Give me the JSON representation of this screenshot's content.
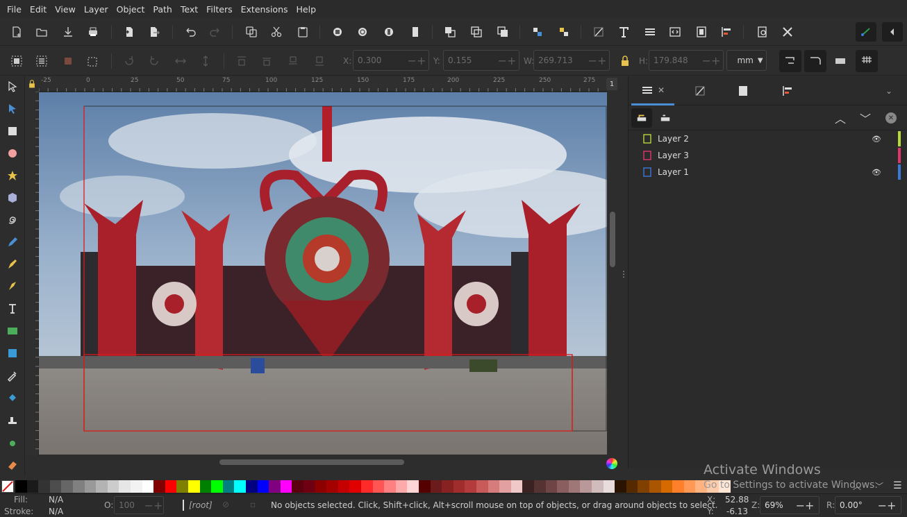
{
  "menu": [
    "File",
    "Edit",
    "View",
    "Layer",
    "Object",
    "Path",
    "Text",
    "Filters",
    "Extensions",
    "Help"
  ],
  "controls": {
    "x_label": "X:",
    "x_value": "0.300",
    "y_label": "Y:",
    "y_value": "0.155",
    "w_label": "W:",
    "w_value": "269.713",
    "h_label": "H:",
    "h_value": "179.848",
    "unit": "mm"
  },
  "ruler": {
    "h_ticks": [
      "-25",
      "0",
      "25",
      "50",
      "75",
      "100",
      "125",
      "150",
      "175",
      "200",
      "225",
      "250",
      "275"
    ],
    "v_ticks": [
      "0",
      "2",
      "5",
      "5",
      "7",
      "5",
      "1",
      "0",
      "0",
      "1",
      "2",
      "5",
      "1",
      "5",
      "0",
      "1",
      "7",
      "5"
    ]
  },
  "dock": {
    "layers": [
      {
        "name": "Layer 2",
        "color": "#b6d93b",
        "visible": true
      },
      {
        "name": "Layer 3",
        "color": "#e0356b",
        "visible": false
      },
      {
        "name": "Layer 1",
        "color": "#3b79d9",
        "visible": true
      }
    ]
  },
  "status": {
    "fill_label": "Fill:",
    "fill_value": "N/A",
    "stroke_label": "Stroke:",
    "stroke_value": "N/A",
    "opacity_label": "O:",
    "opacity_value": "100",
    "layer": "[root]",
    "message": "No objects selected. Click, Shift+click, Alt+scroll mouse on top of objects, or drag around objects to select.",
    "cursor_x_label": "X:",
    "cursor_x": "52.88",
    "cursor_y_label": "Y:",
    "cursor_y": "-6.13",
    "zoom_label": "Z:",
    "zoom": "69%",
    "rotate_label": "R:",
    "rotate": "0.00°"
  },
  "watermark": {
    "title": "Activate Windows",
    "subtitle": "Go to Settings to activate Windows."
  },
  "colors": {
    "accent": "#4a8fd6",
    "page_border": "#d81b1b"
  },
  "palette": [
    "#000000",
    "#1a1a1a",
    "#333333",
    "#4d4d4d",
    "#666666",
    "#808080",
    "#999999",
    "#b3b3b3",
    "#cccccc",
    "#e6e6e6",
    "#f2f2f2",
    "#ffffff",
    "#800000",
    "#ff0000",
    "#808000",
    "#ffff00",
    "#008000",
    "#00ff00",
    "#008080",
    "#00ffff",
    "#000080",
    "#0000ff",
    "#800080",
    "#ff00ff",
    "#5c0010",
    "#6e0012",
    "#8c0000",
    "#a30000",
    "#c40000",
    "#e00000",
    "#ff2a2a",
    "#ff5555",
    "#ff8080",
    "#ffaaaa",
    "#ffd5d5",
    "#550000",
    "#6b1b1b",
    "#882222",
    "#a02c2c",
    "#b33b3b",
    "#c85a5a",
    "#d67c7c",
    "#e3a0a0",
    "#f0c8c8",
    "#3a2222",
    "#553333",
    "#6e4444",
    "#8a5e5e",
    "#a07777",
    "#b89898",
    "#d0bcbc",
    "#e8dcdc",
    "#2a1400",
    "#552a00",
    "#804000",
    "#aa5500",
    "#d46a00",
    "#ff7f2a",
    "#ff9955",
    "#ffb380",
    "#ffccaa",
    "#ffe6d5"
  ]
}
